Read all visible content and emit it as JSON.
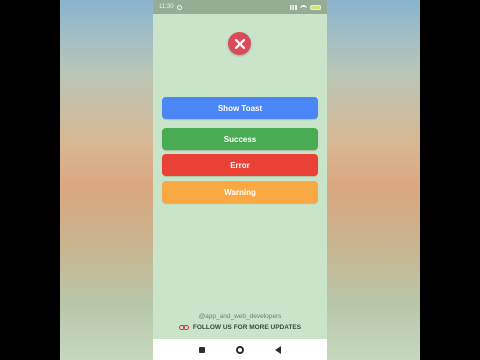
{
  "status_bar": {
    "time": "11:30"
  },
  "buttons": {
    "show_toast": "Show Toast",
    "success": "Success",
    "error": "Error",
    "warning": "Warning"
  },
  "footer": {
    "handle": "@app_and_web_developers",
    "follow": "FOLLOW US FOR MORE UPDATES"
  },
  "colors": {
    "show_toast": "#4a86f5",
    "success": "#4aab55",
    "error": "#ea4137",
    "warning": "#f9a843",
    "close": "#db4a5b",
    "background": "#c9e4c8"
  },
  "icons": [
    "close-icon",
    "link-icon",
    "wifi-icon",
    "battery-icon",
    "nav-recents-icon",
    "nav-home-icon",
    "nav-back-icon"
  ]
}
